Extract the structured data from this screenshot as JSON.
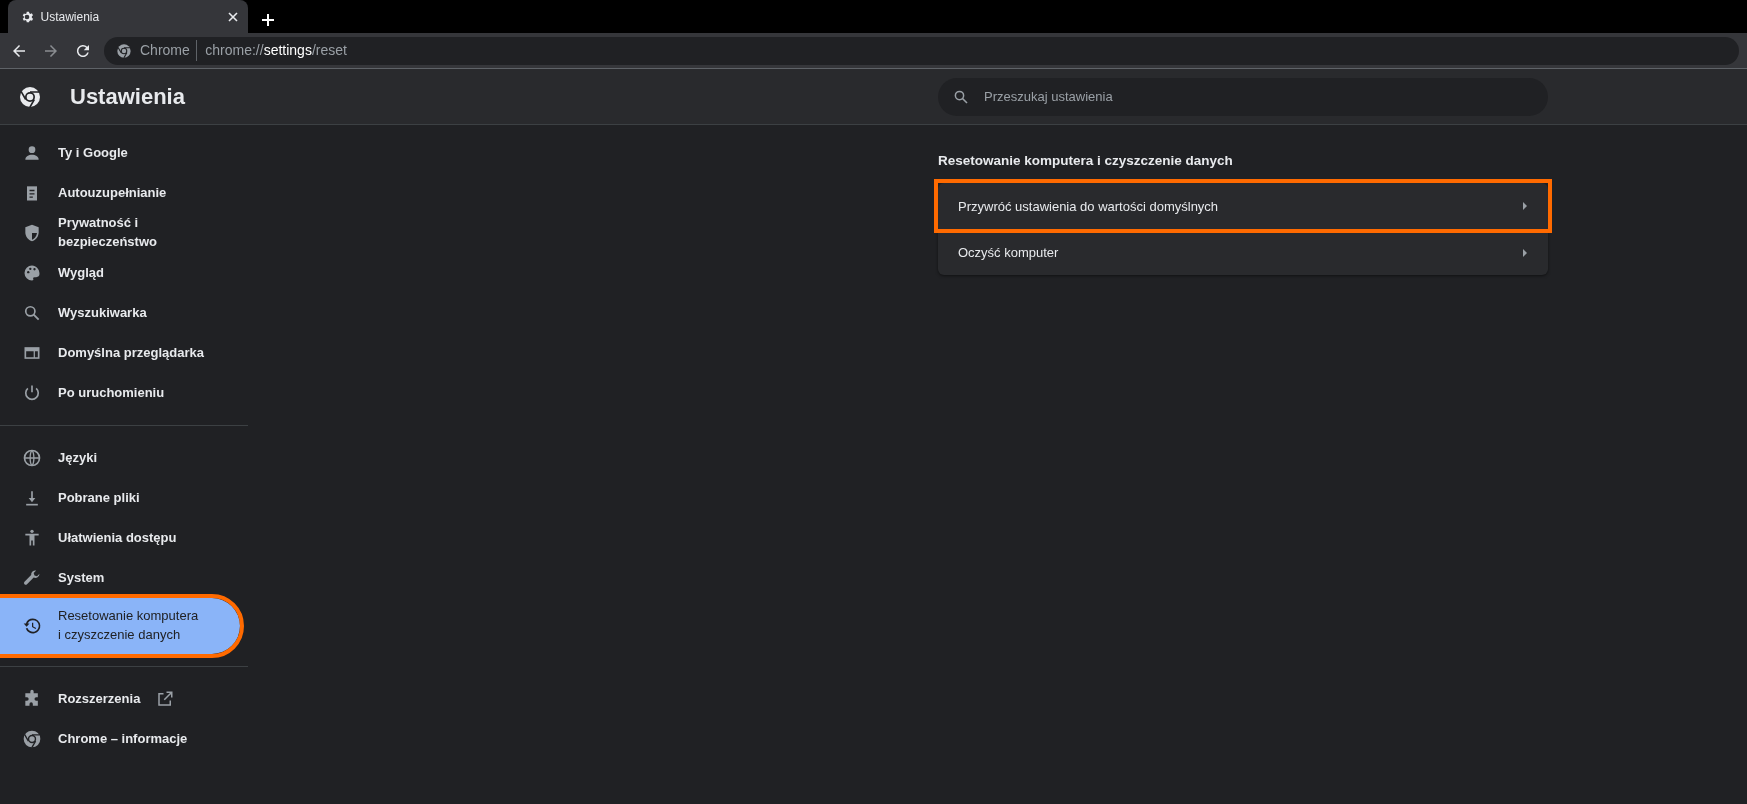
{
  "browser": {
    "tab": {
      "title": "Ustawienia",
      "selected": true
    },
    "address_bar": {
      "site_label": "Chrome",
      "url": [
        {
          "text": "chrome://",
          "emphasis": false
        },
        {
          "text": "settings",
          "emphasis": true
        },
        {
          "text": "/reset",
          "emphasis": false
        }
      ]
    }
  },
  "header": {
    "title": "Ustawienia",
    "search": {
      "placeholder": "Przeszukaj ustawienia"
    }
  },
  "sidebar": {
    "groups": [
      {
        "items": [
          {
            "label": "Ty i Google",
            "selected": false,
            "highlighted": false
          },
          {
            "label": "Autouzupełnianie",
            "selected": false,
            "highlighted": false
          },
          {
            "label": "Prywatność i\nbezpieczeństwo",
            "selected": false,
            "highlighted": false
          },
          {
            "label": "Wygląd",
            "selected": false,
            "highlighted": false
          },
          {
            "label": "Wyszukiwarka",
            "selected": false,
            "highlighted": false
          },
          {
            "label": "Domyślna przeglądarka",
            "selected": false,
            "highlighted": false
          },
          {
            "label": "Po uruchomieniu",
            "selected": false,
            "highlighted": false
          }
        ]
      },
      {
        "items": [
          {
            "label": "Języki",
            "selected": false,
            "highlighted": false
          },
          {
            "label": "Pobrane pliki",
            "selected": false,
            "highlighted": false
          },
          {
            "label": "Ułatwienia dostępu",
            "selected": false,
            "highlighted": false
          },
          {
            "label": "System",
            "selected": false,
            "highlighted": false
          },
          {
            "label": "Resetowanie komputera\ni czyszczenie danych",
            "selected": true,
            "highlighted": true
          }
        ]
      },
      {
        "items": [
          {
            "label": "Rozszerzenia",
            "selected": false,
            "highlighted": false,
            "external": true
          },
          {
            "label": "Chrome – informacje",
            "selected": false,
            "highlighted": false
          }
        ]
      }
    ]
  },
  "section": {
    "title": "Resetowanie komputera i czyszczenie danych",
    "rows": [
      {
        "label": "Przywróć ustawienia do wartości domyślnych",
        "highlighted": true
      },
      {
        "label": "Oczyść komputer",
        "highlighted": false
      }
    ]
  }
}
